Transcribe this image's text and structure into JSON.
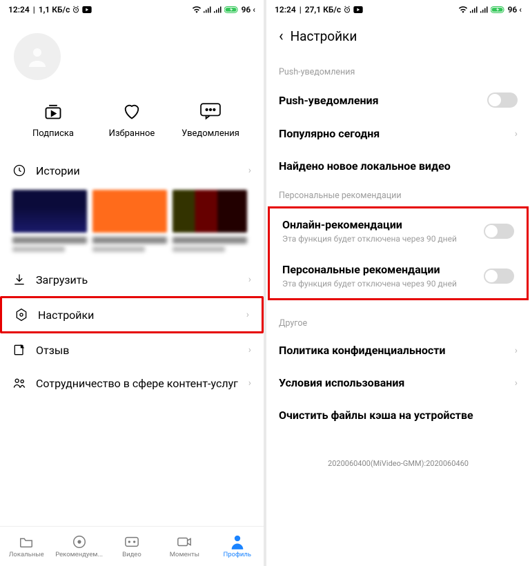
{
  "left": {
    "status": {
      "time": "12:24",
      "speed": "1,1 КБ/c",
      "battery": "96",
      "suffix": "‹"
    },
    "actions": [
      {
        "label": "Подписка"
      },
      {
        "label": "Избранное"
      },
      {
        "label": "Уведомления"
      }
    ],
    "history_label": "Истории",
    "menu": [
      {
        "label": "Загрузить"
      },
      {
        "label": "Настройки"
      },
      {
        "label": "Отзыв"
      },
      {
        "label": "Сотрудничество в сфере контент-услуг"
      }
    ],
    "tabs": [
      {
        "label": "Локальные"
      },
      {
        "label": "Рекомендуем..."
      },
      {
        "label": "Видео"
      },
      {
        "label": "Моменты"
      },
      {
        "label": "Профиль"
      }
    ]
  },
  "right": {
    "status": {
      "time": "12:24",
      "speed": "27,1 КБ/c",
      "battery": "96",
      "suffix": "‹"
    },
    "title": "Настройки",
    "sections": {
      "push": {
        "title": "Push-уведомления",
        "rows": [
          {
            "label": "Push-уведомления",
            "type": "toggle"
          },
          {
            "label": "Популярно сегодня",
            "type": "chev"
          },
          {
            "label": "Найдено новое локальное видео",
            "type": "none"
          }
        ]
      },
      "personal": {
        "title": "Персональные рекомендации",
        "rows": [
          {
            "label": "Онлайн-рекомендации",
            "desc": "Эта функция будет отключена через 90 дней",
            "type": "toggle"
          },
          {
            "label": "Персональные рекомендации",
            "desc": "Эта функция будет отключена через 90 дней",
            "type": "toggle"
          }
        ]
      },
      "other": {
        "title": "Другое",
        "rows": [
          {
            "label": "Политика конфиденциальности",
            "type": "chev"
          },
          {
            "label": "Условия использования",
            "type": "chev"
          },
          {
            "label": "Очистить файлы кэша на устройстве",
            "type": "none"
          }
        ]
      }
    },
    "version": "2020060400(MiVideo-GMM):2020060460"
  }
}
